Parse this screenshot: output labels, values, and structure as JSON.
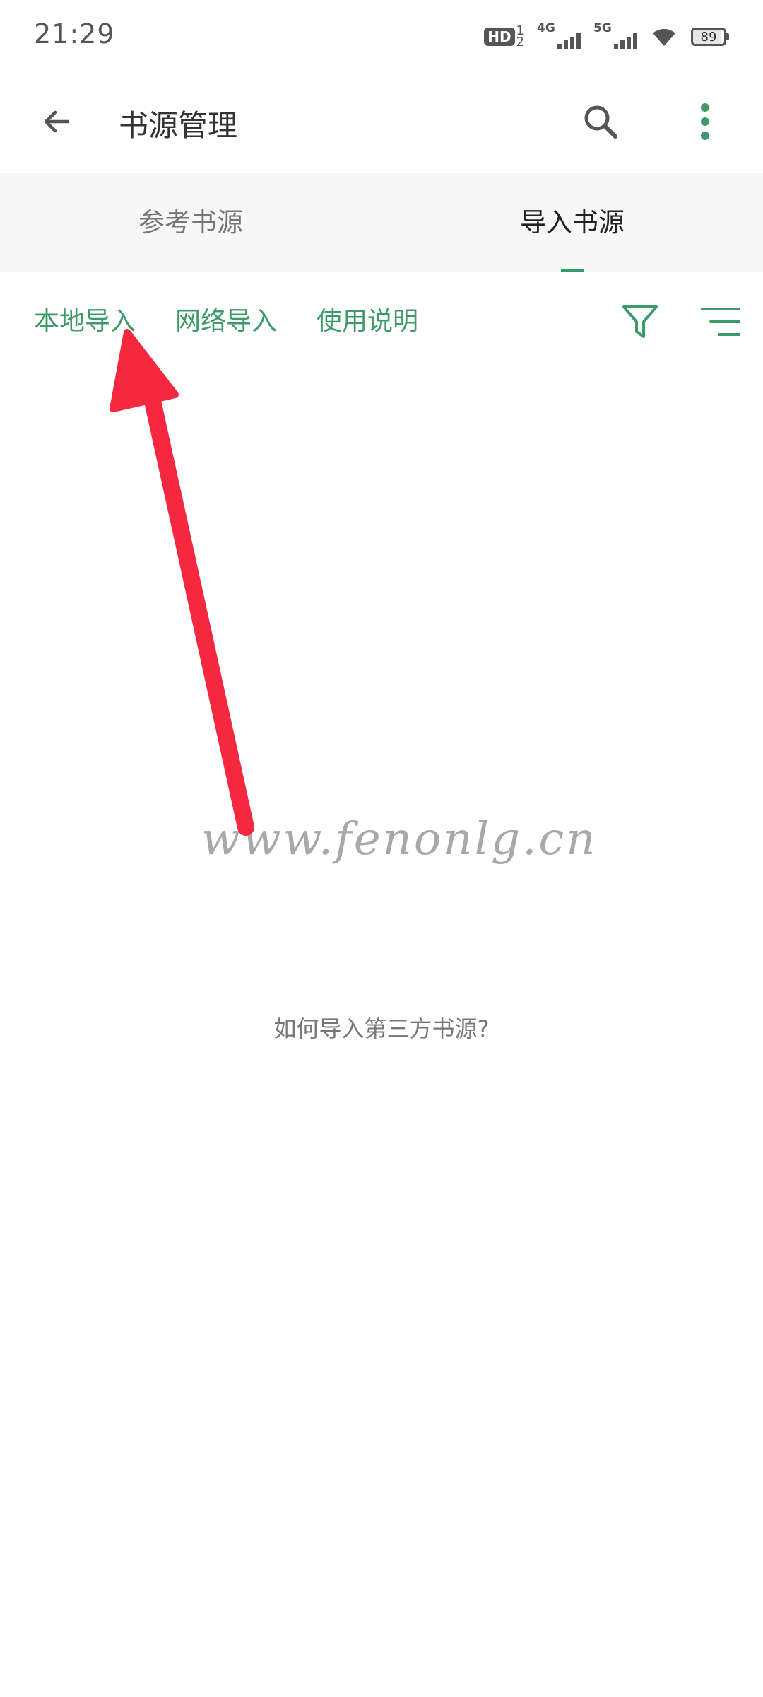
{
  "status_bar": {
    "time": "21:29",
    "hd_label": "HD",
    "hd_sup": "1",
    "hd_sub": "2",
    "signal1_label": "4G",
    "signal2_label": "5G",
    "battery_level": "89"
  },
  "toolbar": {
    "title": "书源管理",
    "back_icon": "arrow-left-icon",
    "search_icon": "search-icon",
    "more_icon": "more-vertical-icon"
  },
  "tabs": [
    {
      "label": "参考书源",
      "active": false
    },
    {
      "label": "导入书源",
      "active": true
    }
  ],
  "actions": {
    "local_import": "本地导入",
    "network_import": "网络导入",
    "instructions": "使用说明",
    "filter_icon": "filter-icon",
    "sort_icon": "sort-icon"
  },
  "watermark": "www.fenonlg.cn",
  "empty_hint": "如何导入第三方书源?",
  "colors": {
    "accent": "#3f9a6b",
    "tab_bg": "#f7f7f7",
    "annotation": "#f5283f"
  }
}
